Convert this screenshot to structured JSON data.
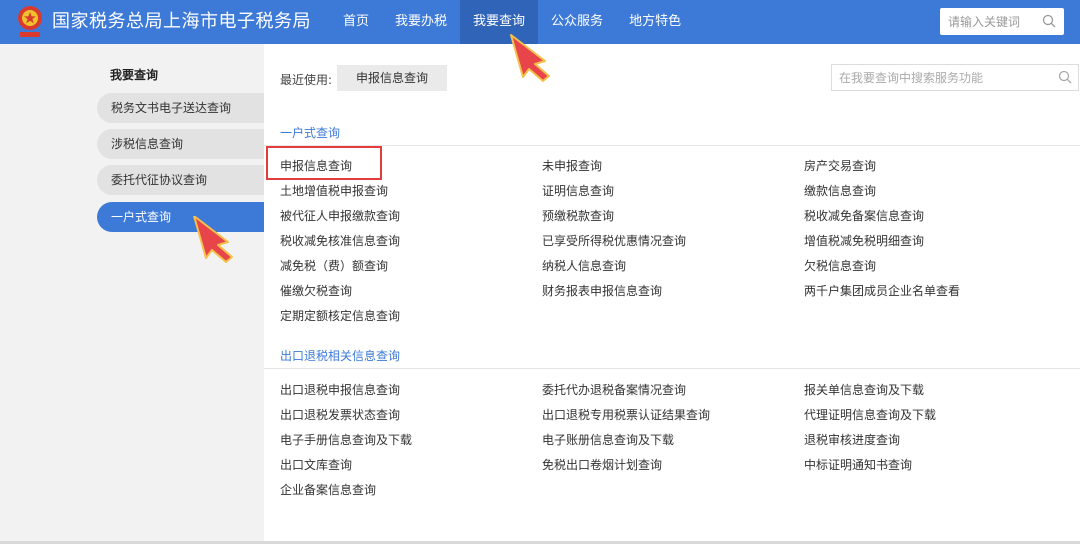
{
  "header": {
    "site_title": "国家税务总局上海市电子税务局",
    "nav": [
      "首页",
      "我要办税",
      "我要查询",
      "公众服务",
      "地方特色"
    ],
    "active_nav_index": 2,
    "search_placeholder": "请输入关键词"
  },
  "sidebar": {
    "heading": "我要查询",
    "items": [
      "税务文书电子送达查询",
      "涉税信息查询",
      "委托代征协议查询",
      "一户式查询"
    ],
    "active_index": 3
  },
  "main": {
    "recent_label": "最近使用:",
    "recent_tag": "申报信息查询",
    "search_placeholder": "在我要查询中搜索服务功能",
    "sections": [
      {
        "title": "一户式查询",
        "columns": [
          [
            "申报信息查询",
            "土地增值税申报查询",
            "被代征人申报缴款查询",
            "税收减免核准信息查询",
            "减免税（费）额查询",
            "催缴欠税查询",
            "定期定额核定信息查询"
          ],
          [
            "未申报查询",
            "证明信息查询",
            "预缴税款查询",
            "已享受所得税优惠情况查询",
            "纳税人信息查询",
            "财务报表申报信息查询"
          ],
          [
            "房产交易查询",
            "缴款信息查询",
            "税收减免备案信息查询",
            "增值税减免税明细查询",
            "欠税信息查询",
            "两千户集团成员企业名单查看"
          ]
        ]
      },
      {
        "title": "出口退税相关信息查询",
        "columns": [
          [
            "出口退税申报信息查询",
            "出口退税发票状态查询",
            "电子手册信息查询及下载",
            "出口文库查询",
            "企业备案信息查询"
          ],
          [
            "委托代办退税备案情况查询",
            "出口退税专用税票认证结果查询",
            "电子账册信息查询及下载",
            "免税出口卷烟计划查询"
          ],
          [
            "报关单信息查询及下载",
            "代理证明信息查询及下载",
            "退税审核进度查询",
            "中标证明通知书查询"
          ]
        ]
      }
    ]
  },
  "colors": {
    "header_blue": "#3d7ad8",
    "active_nav": "#2f64b9",
    "highlight_red": "#e23c3c",
    "pointer_red": "#e8454a"
  },
  "icons": [
    "tax-emblem-icon",
    "search-icon",
    "pointer-hand-icon"
  ]
}
